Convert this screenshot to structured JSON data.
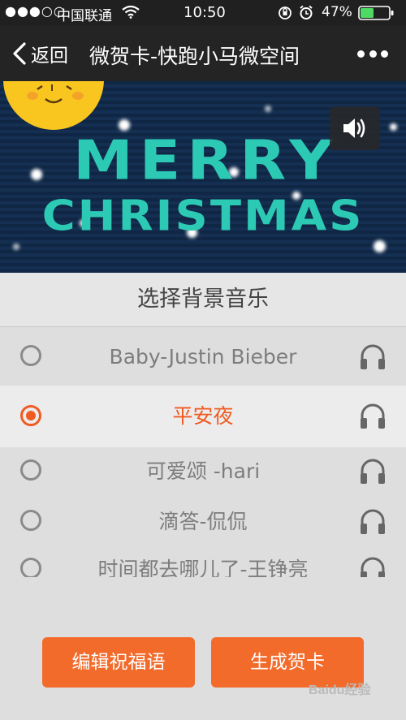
{
  "status_bar": {
    "signal_text": "●●●○○",
    "carrier": "中国联通",
    "time": "10:50",
    "battery": "47%",
    "battery_level": 0.47,
    "icons": [
      "signal-dots-icon",
      "wifi-icon",
      "orientation-lock-icon",
      "alarm-icon",
      "battery-icon"
    ]
  },
  "nav": {
    "back_label": "返回",
    "title": "微贺卡-快跑小马微空间",
    "more_icon": "more-dots-icon"
  },
  "banner": {
    "line1": "MERRY",
    "line2": "CHRISTMAS",
    "sound_icon": "speaker-icon"
  },
  "music_panel": {
    "title": "选择背景音乐",
    "tracks": [
      {
        "label": "Baby-Justin Bieber",
        "selected": false
      },
      {
        "label": "平安夜",
        "selected": true
      },
      {
        "label": "可爱颂 -hari",
        "selected": false
      },
      {
        "label": "滴答-侃侃",
        "selected": false
      },
      {
        "label": "时间都去哪儿了-王铮亮",
        "selected": false
      }
    ],
    "preview_icon": "headphones-icon"
  },
  "actions": {
    "edit_label": "编辑祝福语",
    "generate_label": "生成贺卡"
  },
  "watermark": "Baidu经验",
  "colors": {
    "accent": "#f26b2b",
    "selected_text": "#f05b22",
    "banner_bg": "#0f2744",
    "title_teal": "#2cc9b4"
  }
}
